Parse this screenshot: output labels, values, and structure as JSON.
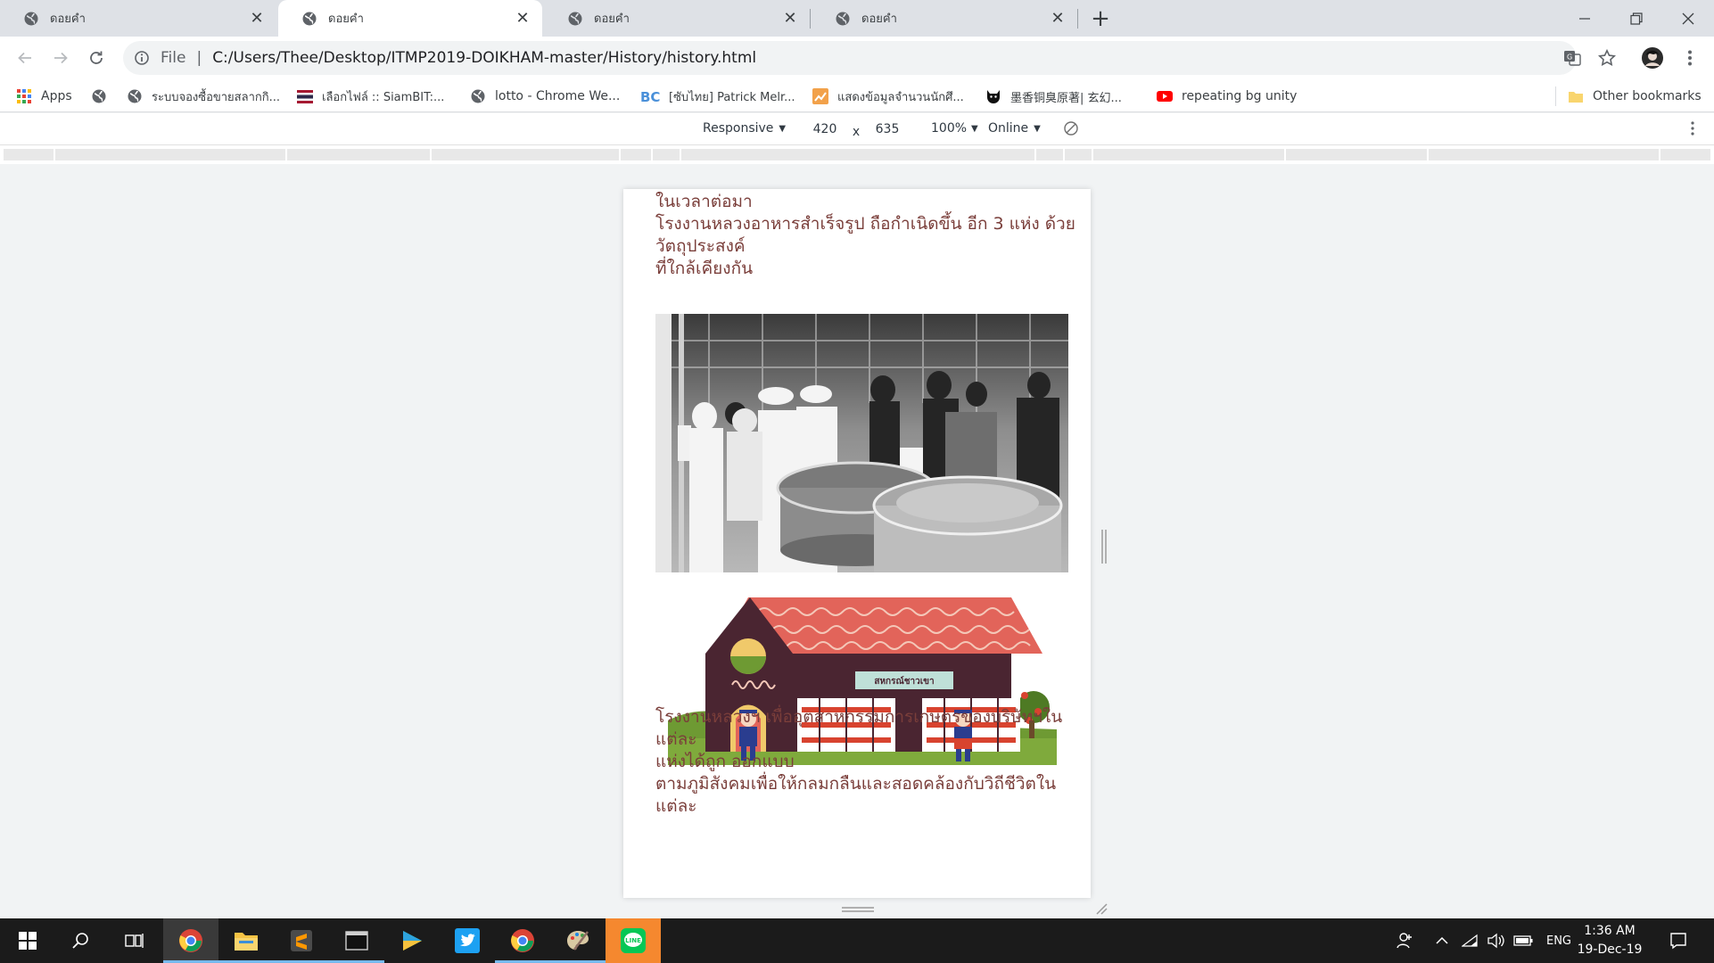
{
  "tabs": [
    {
      "title": "ดอยคำ",
      "active": false
    },
    {
      "title": "ดอยคำ",
      "active": true
    },
    {
      "title": "ดอยคำ",
      "active": false
    },
    {
      "title": "ดอยคำ",
      "active": false
    }
  ],
  "omnibox": {
    "scheme": "File",
    "url": "C:/Users/Thee/Desktop/ITMP2019-DOIKHAM-master/History/history.html"
  },
  "bookmarks": [
    {
      "label": "Apps",
      "icon": "apps-grid-icon"
    },
    {
      "label": "",
      "icon": "globe-icon"
    },
    {
      "label": "ระบบจองซื้อขายสลากกิ...",
      "icon": "globe-icon"
    },
    {
      "label": "เลือกไฟล์ :: SiamBIT:...",
      "icon": "thai-flag-icon"
    },
    {
      "label": "lotto - Chrome We...",
      "icon": "globe-icon"
    },
    {
      "label": "[ซับไทย] Patrick Melr...",
      "icon": "bc-icon"
    },
    {
      "label": "แสดงข้อมูลจำนวนนักศึ...",
      "icon": "chart-icon"
    },
    {
      "label": "墨香铜臭原著| 玄幻...",
      "icon": "black-cat-icon"
    },
    {
      "label": "repeating bg unity",
      "icon": "youtube-icon"
    }
  ],
  "other_bookmarks": "Other bookmarks",
  "devtools": {
    "device": "Responsive",
    "width": "420",
    "times": "x",
    "height": "635",
    "zoom": "100%",
    "network": "Online"
  },
  "page": {
    "paragraph1": [
      "ในเวลาต่อมา",
      "โรงงานหลวงอาหารสำเร็จรูป ถือกำเนิดขึ้น อีก 3 แห่ง ด้วย",
      "วัตถุประสงค์",
      "ที่ใกล้เคียงกัน"
    ],
    "shop_sign": "สหกรณ์ชาวเขา",
    "paragraph2": [
      "โรงงานหลวงฯ เพื่ออุตสาหกรรมการเกษตรของบริษัทฯในแต่ละ",
      "แห่งได้ถูก ออกแบบ",
      "ตามภูมิสังคมเพื่อให้กลมกลืนและสอดคล้องกับวิถีชีวิตในแต่ละ"
    ]
  },
  "taskbar": {
    "language": "ENG",
    "time": "1:36 AM",
    "date": "19-Dec-19"
  },
  "colors": {
    "page_text": "#7a3e3a",
    "roof": "#e2645a",
    "building": "#4a2531",
    "grass": "#6e9a33"
  }
}
